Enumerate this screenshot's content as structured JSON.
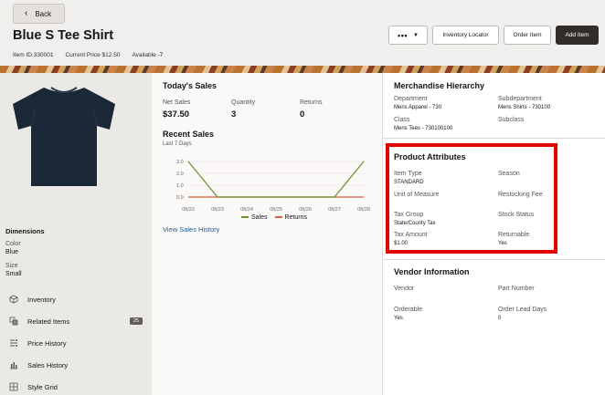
{
  "header": {
    "back_label": "Back",
    "title": "Blue S Tee Shirt",
    "item_id": "Item ID 330001",
    "current_price": "Current Price $12.50",
    "available_label": "Available",
    "available_value": "-7",
    "more_label": "•••",
    "inventory_locator_label": "Inventory Locator",
    "order_item_label": "Order Item",
    "add_item_label": "Add Item"
  },
  "left": {
    "dimensions_title": "Dimensions",
    "color_label": "Color",
    "color_value": "Blue",
    "size_label": "Size",
    "size_value": "Small",
    "nav": [
      {
        "label": "Inventory",
        "icon": "box-icon"
      },
      {
        "label": "Related Items",
        "icon": "related-items-icon",
        "badge": "25"
      },
      {
        "label": "Price History",
        "icon": "price-history-icon"
      },
      {
        "label": "Sales History",
        "icon": "bar-chart-icon"
      },
      {
        "label": "Style Grid",
        "icon": "grid-icon"
      }
    ]
  },
  "sales": {
    "title": "Today's Sales",
    "net_sales_label": "Net Sales",
    "net_sales_value": "$37.50",
    "quantity_label": "Quantity",
    "quantity_value": "3",
    "returns_label": "Returns",
    "returns_value": "0",
    "recent_title": "Recent Sales",
    "recent_sub": "Last 7 Days",
    "view_history_link": "View Sales History"
  },
  "chart_data": {
    "type": "line",
    "x": [
      "08/22",
      "08/23",
      "08/24",
      "08/25",
      "08/26",
      "08/27",
      "08/28"
    ],
    "series": [
      {
        "name": "Sales",
        "color": "#6b8f2a",
        "values": [
          3,
          0,
          0,
          0,
          0,
          0,
          3
        ]
      },
      {
        "name": "Returns",
        "color": "#d7623a",
        "values": [
          0,
          0,
          0,
          0,
          0,
          0,
          0
        ]
      }
    ],
    "yticks": [
      "3.0",
      "2.0",
      "1.0",
      "0.0"
    ],
    "ylim": [
      0,
      3
    ],
    "legend": "bottom"
  },
  "merch": {
    "title": "Merchandise Hierarchy",
    "department_label": "Department",
    "department_value": "Mens Apparel - 730",
    "subdepartment_label": "Subdepartment",
    "subdepartment_value": "Mens Shirts - 730100",
    "class_label": "Class",
    "class_value": "Mens Tees - 730100100",
    "subclass_label": "Subclass"
  },
  "attributes": {
    "title": "Product Attributes",
    "item_type_label": "Item Type",
    "item_type_value": "STANDARD",
    "season_label": "Season",
    "uom_label": "Unit of Measure",
    "restocking_label": "Restocking Fee",
    "tax_group_label": "Tax Group",
    "tax_group_value": "State/County Tax",
    "stock_status_label": "Stock Status",
    "tax_amount_label": "Tax Amount",
    "tax_amount_value": "$1.00",
    "returnable_label": "Returnable",
    "returnable_value": "Yes",
    "highlight_color": "#e00000"
  },
  "vendor": {
    "title": "Vendor Information",
    "vendor_label": "Vendor",
    "part_number_label": "Part Number",
    "orderable_label": "Orderable",
    "orderable_value": "Yes",
    "lead_days_label": "Order Lead Days",
    "lead_days_value": "0"
  }
}
